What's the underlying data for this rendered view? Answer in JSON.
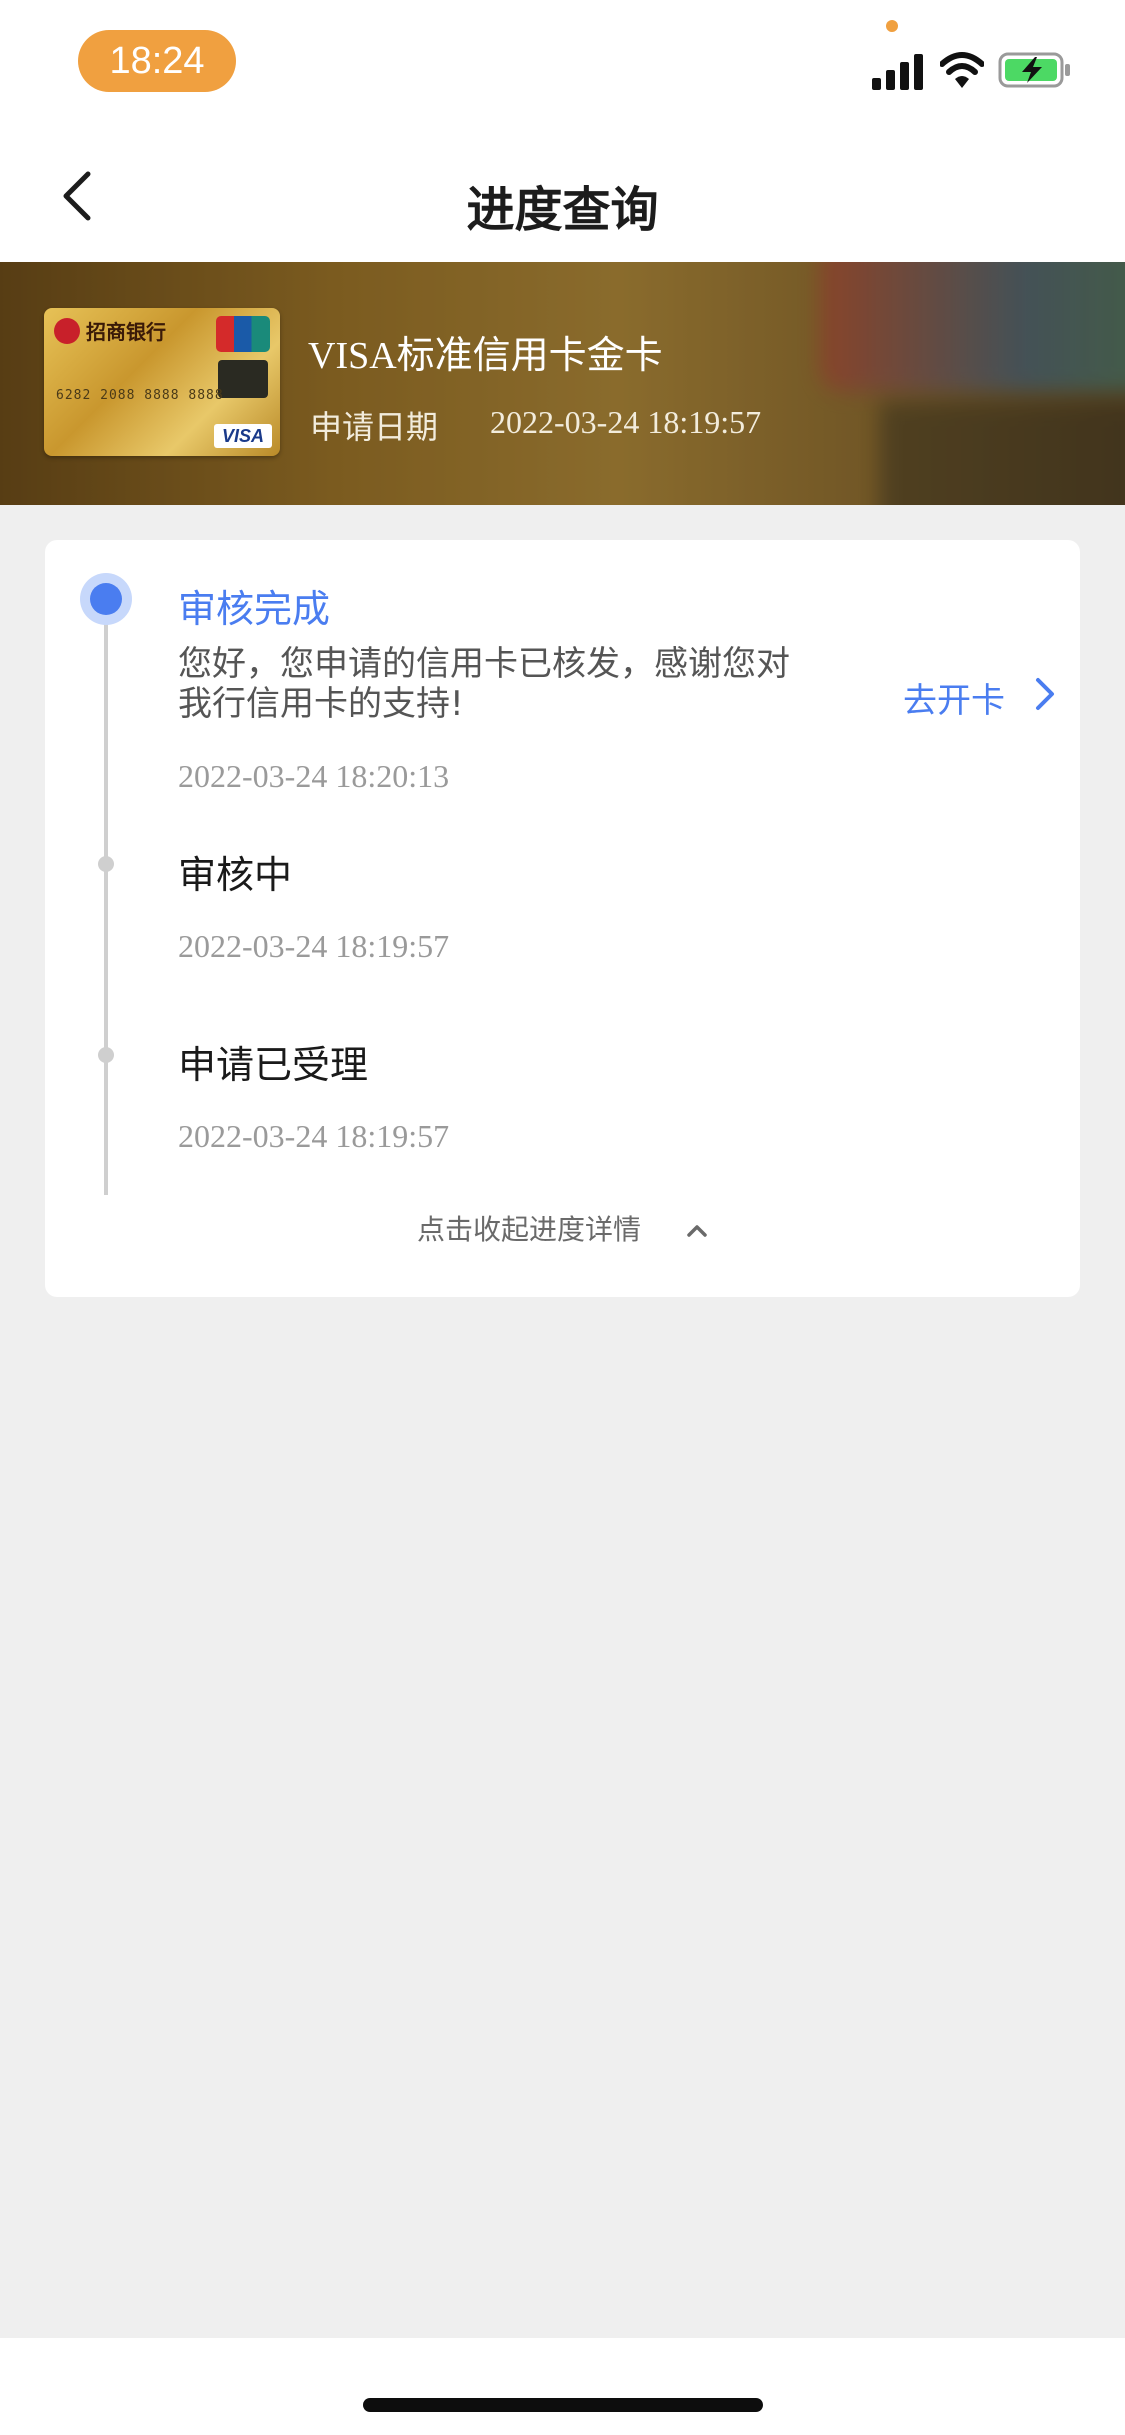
{
  "status_bar": {
    "time": "18:24"
  },
  "nav": {
    "title": "进度查询"
  },
  "card": {
    "bank_name": "招商银行",
    "number": "6282 2088 8888 8888",
    "brand": "VISA",
    "product_name": "VISA标准信用卡金卡",
    "apply_date_label": "申请日期",
    "apply_date_value": "2022-03-24 18:19:57"
  },
  "progress": {
    "steps": [
      {
        "title": "审核完成",
        "message": "您好，您申请的信用卡已核发，感谢您对我行信用卡的支持!",
        "time": "2022-03-24 18:20:13",
        "action": "去开卡"
      },
      {
        "title": "审核中",
        "time": "2022-03-24 18:19:57"
      },
      {
        "title": "申请已受理",
        "time": "2022-03-24 18:19:57"
      }
    ],
    "collapse_label": "点击收起进度详情"
  },
  "colors": {
    "accent": "#4a7df0",
    "status_pill": "#f0a040",
    "background": "#efefef"
  }
}
